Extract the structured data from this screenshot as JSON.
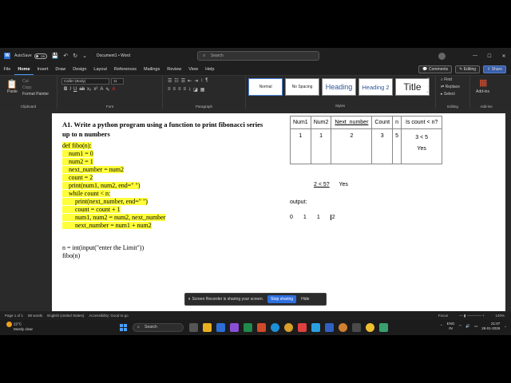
{
  "titlebar": {
    "autosave_label": "AutoSave",
    "autosave_state": "Off",
    "document_name": "Document1 • Word",
    "search_placeholder": "Search"
  },
  "menu": {
    "items": [
      "File",
      "Home",
      "Insert",
      "Draw",
      "Design",
      "Layout",
      "References",
      "Mailings",
      "Review",
      "View",
      "Help"
    ],
    "active": "Home",
    "comments_label": "Comments",
    "editing_label": "Editing",
    "share_label": "Share"
  },
  "ribbon": {
    "clipboard": {
      "paste": "Paste",
      "cut": "Cut",
      "copy": "Copy",
      "format_painter": "Format Painter",
      "label": "Clipboard"
    },
    "font": {
      "name": "Calibri (Body)",
      "size": "11",
      "label": "Font"
    },
    "paragraph_label": "Paragraph",
    "styles": {
      "items": [
        "Normal",
        "No Spacing",
        "Heading",
        "Heading 2",
        "Title"
      ],
      "label": "Styles"
    },
    "editing": {
      "find": "Find",
      "replace": "Replace",
      "select": "Select",
      "label": "Editing"
    },
    "addins": {
      "button": "Add-ins",
      "label": "Add-ins"
    }
  },
  "doc": {
    "question": "A1. Write a python program using a function to print fibonacci series up to n numbers",
    "code": [
      "def fibo(n):",
      "    num1 = 0",
      "    num2 = 1",
      "    next_number = num2",
      "    count = 2",
      "    print(num1, num2, end=\" \")",
      "    while count < n:",
      "        print(next_number, end=\" \")",
      "        count = count + 1",
      "        num1, num2 = num2, next_number",
      "        next_number = num1 + num2"
    ],
    "code_after": [
      "n = int(input(\"enter the Limit\"))",
      "fibo(n)"
    ],
    "table": {
      "headers": [
        "Num1",
        "Num2",
        "Next_number",
        "Count",
        "n",
        "Is count < n?"
      ],
      "row": [
        "1",
        "1",
        "2",
        "3",
        "5",
        "3 < 5"
      ],
      "row_note": "Yes"
    },
    "check": {
      "expr": "2  < 5?",
      "answer": "Yes"
    },
    "output_label": "output:",
    "output_values": [
      "0",
      "1",
      "1",
      "2"
    ]
  },
  "banner": {
    "message": "Screen Recorder is sharing your screen.",
    "stop": "Stop sharing",
    "hide": "Hide"
  },
  "statusbar": {
    "page": "Page 1 of 1",
    "words": "88 words",
    "language": "English (United States)",
    "accessibility": "Accessibility: Good to go",
    "focus": "Focus",
    "zoom": "140%"
  },
  "taskbar": {
    "temp": "22°C",
    "weather": "Mostly clear",
    "search": "Search",
    "lang": "ENG",
    "region": "IN",
    "time": "21:07",
    "date": "28-01-2026"
  }
}
